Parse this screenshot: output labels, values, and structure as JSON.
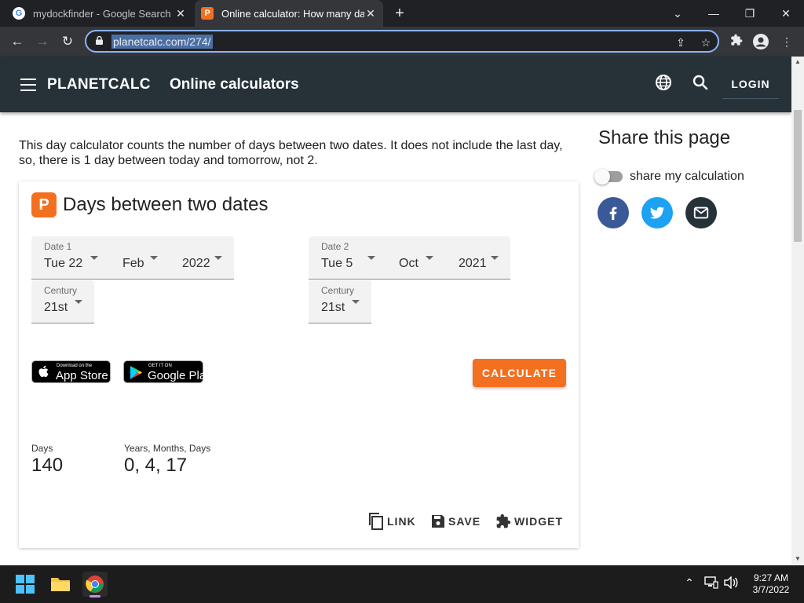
{
  "browser": {
    "tabs": [
      {
        "title": "mydockfinder - Google Search",
        "favicon": "google-favicon",
        "active": false
      },
      {
        "title": "Online calculator: How many day",
        "favicon": "planetcalc-favicon",
        "active": true
      }
    ],
    "new_tab_glyph": "+",
    "url": "planetcalc.com/274/"
  },
  "site": {
    "brand": "PLANETCALC",
    "subtitle": "Online calculators",
    "login": "LOGIN",
    "header_color": "#263238",
    "accent": "#f37021"
  },
  "page": {
    "intro": "This day calculator counts the number of days between two dates. It does not include the last day, so, there is 1 day between today and tomorrow, not 2."
  },
  "calculator": {
    "title": "Days between two dates",
    "logo_letter": "P",
    "date1": {
      "label": "Date 1",
      "day": "Tue 22",
      "month": "Feb",
      "year": "2022",
      "century_label": "Century",
      "century": "21st"
    },
    "date2": {
      "label": "Date 2",
      "day": "Tue 5",
      "month": "Oct",
      "year": "2021",
      "century_label": "Century",
      "century": "21st"
    },
    "app_store": {
      "small": "Download on the",
      "big": "App Store"
    },
    "google_play": {
      "small": "GET IT ON",
      "big": "Google Play"
    },
    "calculate": "CALCULATE",
    "results": {
      "days_label": "Days",
      "days_value": "140",
      "ymd_label": "Years, Months, Days",
      "ymd_value": "0, 4, 17"
    },
    "actions": {
      "link": "LINK",
      "save": "SAVE",
      "widget": "WIDGET"
    }
  },
  "share": {
    "title": "Share this page",
    "toggle_label": "share my calculation",
    "toggle_on": false,
    "networks": [
      "facebook",
      "twitter",
      "email"
    ]
  },
  "taskbar": {
    "time": "9:27 AM",
    "date": "3/7/2022"
  }
}
